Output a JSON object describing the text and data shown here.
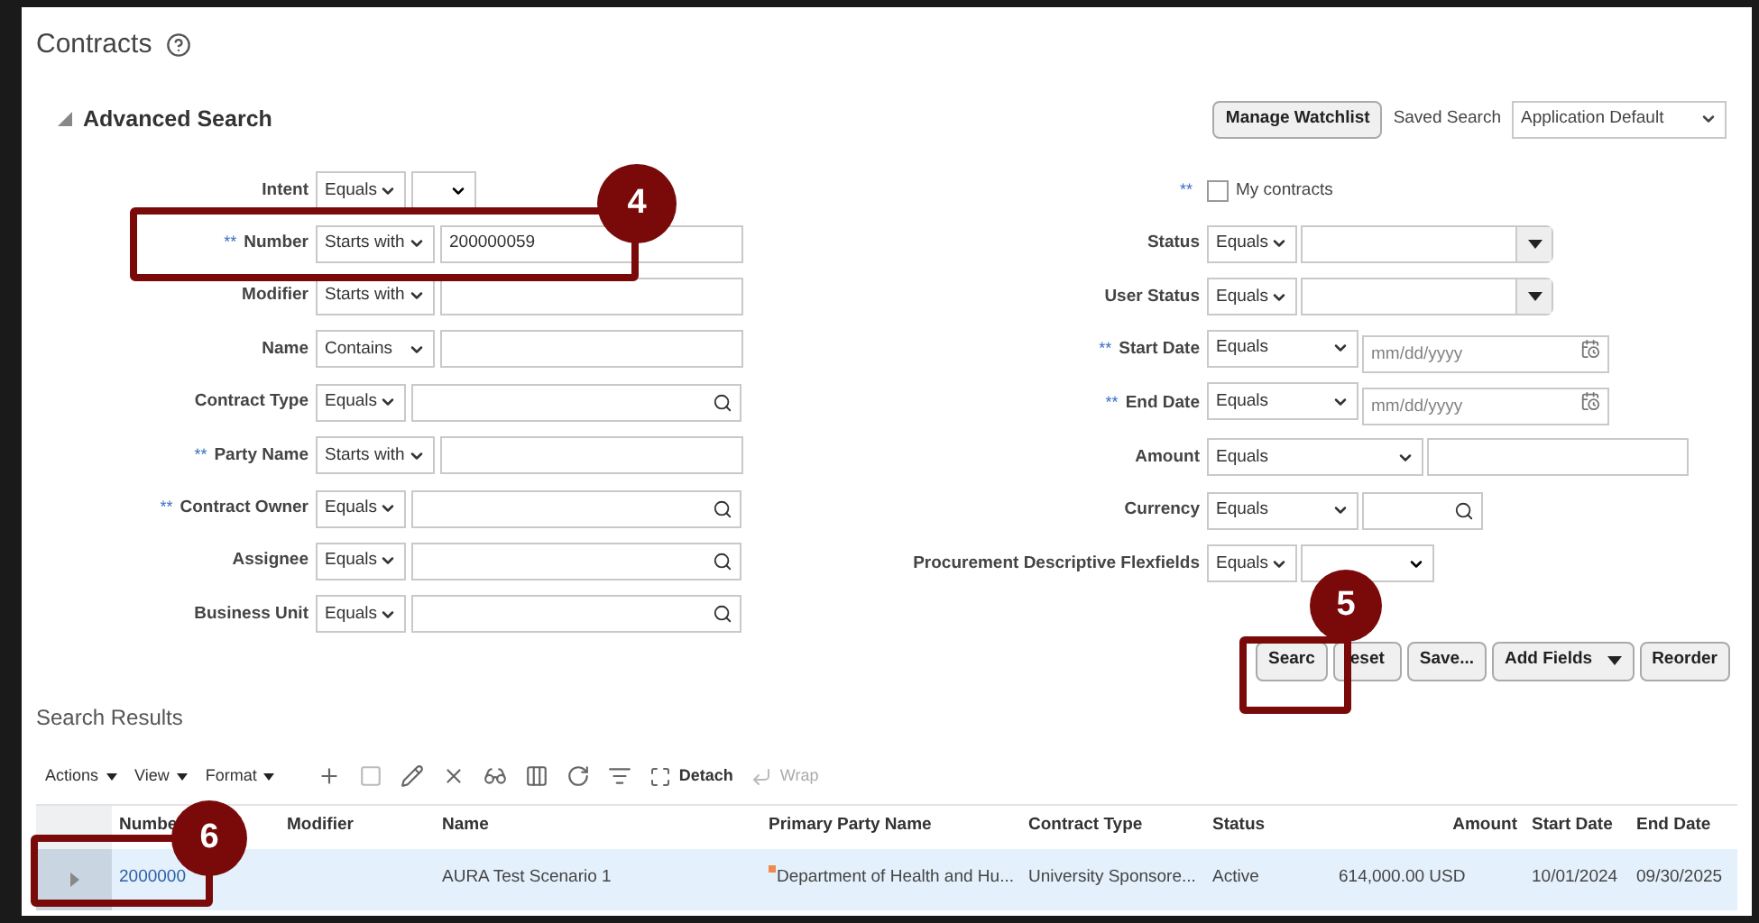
{
  "page": {
    "title": "Contracts"
  },
  "advanced_search": {
    "title": "Advanced Search",
    "expanded": true,
    "watchlist_button": "Manage Watchlist",
    "saved_search_label": "Saved Search",
    "saved_search_value": "Application Default"
  },
  "left_fields": [
    {
      "kind": "select-select",
      "label": "Intent",
      "operator": "Equals"
    },
    {
      "kind": "text",
      "label": "Number",
      "marker": "**",
      "operator": "Starts with",
      "value": "200000059"
    },
    {
      "kind": "text",
      "label": "Modifier",
      "operator": "Starts with"
    },
    {
      "kind": "text",
      "label": "Name",
      "operator": "Contains"
    },
    {
      "kind": "lookup",
      "label": "Contract Type",
      "operator": "Equals"
    },
    {
      "kind": "text",
      "label": "Party Name",
      "marker": "**",
      "operator": "Starts with"
    },
    {
      "kind": "lookup",
      "label": "Contract Owner",
      "marker": "**",
      "operator": "Equals"
    },
    {
      "kind": "lookup",
      "label": "Assignee",
      "operator": "Equals"
    },
    {
      "kind": "lookup",
      "label": "Business Unit",
      "operator": "Equals"
    }
  ],
  "right_fields": [
    {
      "kind": "checkbox",
      "label": "My contracts",
      "marker": "**",
      "checked": false
    },
    {
      "kind": "combo",
      "label": "Status",
      "operator": "Equals"
    },
    {
      "kind": "combo",
      "label": "User Status",
      "operator": "Equals"
    },
    {
      "kind": "date",
      "label": "Start Date",
      "marker": "**",
      "operator": "Equals",
      "placeholder": "mm/dd/yyyy"
    },
    {
      "kind": "date",
      "label": "End Date",
      "marker": "**",
      "operator": "Equals",
      "placeholder": "mm/dd/yyyy"
    },
    {
      "kind": "amount",
      "label": "Amount",
      "operator": "Equals"
    },
    {
      "kind": "currency",
      "label": "Currency",
      "operator": "Equals"
    },
    {
      "kind": "select-select",
      "label": "Procurement Descriptive Flexfields",
      "operator": "Equals"
    }
  ],
  "search_buttons": [
    {
      "label": "Searc",
      "menu": false
    },
    {
      "label": "eset",
      "menu": false
    },
    {
      "label": "Save...",
      "menu": false
    },
    {
      "label": "Add Fields",
      "menu": true
    },
    {
      "label": "Reorder",
      "menu": false
    }
  ],
  "results": {
    "title": "Search Results",
    "menus": [
      "Actions",
      "View",
      "Format"
    ],
    "toolbar": [
      {
        "kind": "add",
        "disabled": false
      },
      {
        "kind": "delete",
        "disabled": true
      },
      {
        "kind": "edit",
        "disabled": false
      },
      {
        "kind": "close",
        "disabled": false
      },
      {
        "kind": "glasses",
        "disabled": false
      },
      {
        "kind": "freeze",
        "disabled": false
      },
      {
        "kind": "refresh",
        "disabled": false
      },
      {
        "kind": "filter",
        "disabled": false
      },
      {
        "kind": "detach",
        "label": "Detach",
        "disabled": false
      },
      {
        "kind": "wrap",
        "label": "Wrap",
        "disabled": true
      }
    ],
    "columns": [
      "Numbe",
      "Modifier",
      "Name",
      "Primary Party Name",
      "Contract Type",
      "Status",
      "Amount",
      "Start Date",
      "End Date"
    ],
    "rows": [
      {
        "selected": true,
        "cells": [
          "2000000",
          null,
          "AURA Test Scenario 1",
          "Department of Health and Hu...",
          "University Sponsore...",
          "Active",
          "614,000.00 USD",
          "10/01/2024",
          "09/30/2025"
        ]
      }
    ]
  },
  "callouts": [
    {
      "label": "4"
    },
    {
      "label": "5"
    },
    {
      "label": "6"
    }
  ]
}
